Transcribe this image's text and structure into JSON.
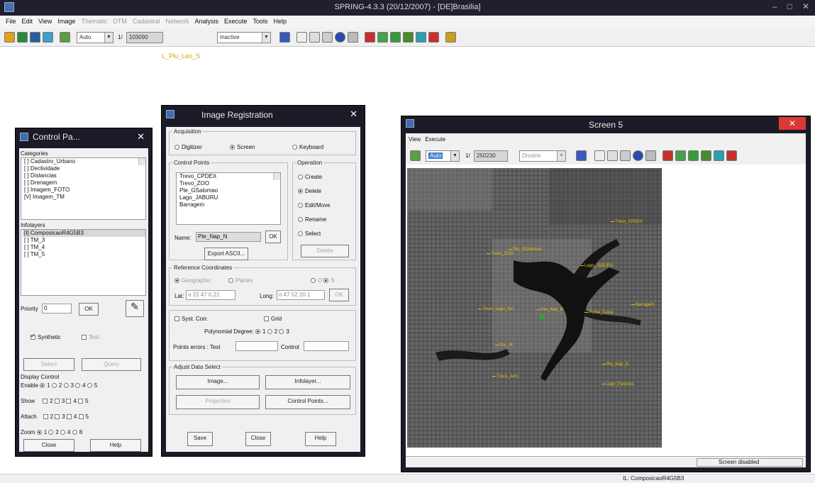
{
  "app": {
    "title": "SPRING-4.3.3 (20/12/2007) - [DE]Brasilia]",
    "menu": [
      {
        "label": "File",
        "disabled": false
      },
      {
        "label": "Edit",
        "disabled": false
      },
      {
        "label": "View",
        "disabled": false
      },
      {
        "label": "Image",
        "disabled": false
      },
      {
        "label": "Thematic",
        "disabled": true
      },
      {
        "label": "DTM",
        "disabled": true
      },
      {
        "label": "Cadastral",
        "disabled": true
      },
      {
        "label": "Network",
        "disabled": true
      },
      {
        "label": "Analysis",
        "disabled": false
      },
      {
        "label": "Execute",
        "disabled": false
      },
      {
        "label": "Tools",
        "disabled": false
      },
      {
        "label": "Help",
        "disabled": false
      }
    ],
    "toolbar": {
      "mode_combo": "Auto",
      "scale_label": "1/",
      "scale_value": "103090",
      "state_combo": "Inactive"
    },
    "layer_label": "L_Plu_Leo_S",
    "status_right": "IL: ComposicaoR4G5B3"
  },
  "control_panel": {
    "title": "Control Pa...",
    "categories_label": "Categories",
    "categories": [
      "[ ] Cadastro_Urbano",
      "[ ] Declividade",
      "[ ] Distancias",
      "[ ] Drenagem",
      "[ ] Imagem_FOTO",
      "[V] Imagem_TM"
    ],
    "infolayers_label": "Infolayers",
    "infolayers": [
      "[I] ComposicaoR4G5B3",
      "[ ] TM_3",
      "[ ] TM_4",
      "[ ] TM_5"
    ],
    "priority_label": "Priority",
    "priority_value": "0",
    "ok_label": "OK",
    "synthetic_label": "Synthetic",
    "text_label": "Text",
    "select_label": "Select",
    "query_label": "Query",
    "display_control_label": "Display Control",
    "enable_label": "Enable",
    "show_label": "Show",
    "attach_label": "Attach",
    "zoom_label": "Zoom",
    "numbers": [
      "1",
      "2",
      "3",
      "4",
      "5"
    ],
    "close_label": "Close",
    "help_label": "Help"
  },
  "image_registration": {
    "title": "Image Registration",
    "acquisition_label": "Acquisition",
    "acq_digitizer": "Digitizer",
    "acq_screen": "Screen",
    "acq_keyboard": "Keyboard",
    "control_points_label": "Control Points",
    "control_points": [
      "Trevo_CPDEX",
      "Trevo_ZOO",
      "Pte_GSalomao",
      "Lago_JABURU",
      "Barragem"
    ],
    "name_label": "Name:",
    "name_value": "Pte_Nap_N",
    "ok_label": "OK",
    "export_label": "Export ASCII...",
    "operation_label": "Operation",
    "op_create": "Create",
    "op_delete": "Delete",
    "op_edit": "Edit/Move",
    "op_rename": "Rename",
    "op_select": "Select",
    "op_button": "Delete",
    "ref_coords_label": "Reference Coordinates",
    "geographic_label": "Geographic",
    "planes_label": "Planes",
    "o_label": "O",
    "s_label": "S",
    "lat_label": "Lat:",
    "lat_value": "o 15 47 0.21",
    "long_label": "Long:",
    "long_value": "o 47 52 20.1",
    "syst_corr_label": "Syst. Corr.",
    "grid_label": "Grid",
    "poly_label": "Polynomial Degree:",
    "poly_options": [
      "1",
      "2",
      "3"
    ],
    "points_error_label": "Points errors : Test",
    "control_label": "Control",
    "adjust_label": "Adjust Data Select",
    "image_btn": "Image...",
    "infolayer_btn": "Infolayer...",
    "projection_btn": "Projection",
    "control_points_btn": "Control Points...",
    "save_btn": "Save",
    "close_btn": "Close",
    "help_btn": "Help"
  },
  "screen5": {
    "title": "Screen 5",
    "menu": [
      "View",
      "Execute"
    ],
    "mode_combo": "Auto",
    "scale_label": "1/",
    "scale_value": "250230",
    "state_combo": "Disable",
    "status": "Screen disabled",
    "points": [
      "Trevo_CPDEX",
      "Pte_GSalomao",
      "Trevo_ZOO",
      "Lago_JABURU",
      "Barragem",
      "Pte_Nap_N",
      "Trevo_Lago_Sul",
      "Ponte_Costa",
      "Pte_Nap_S",
      "Pte_JK",
      "Lago_Paranoa",
      "Trevo_Aero"
    ]
  }
}
